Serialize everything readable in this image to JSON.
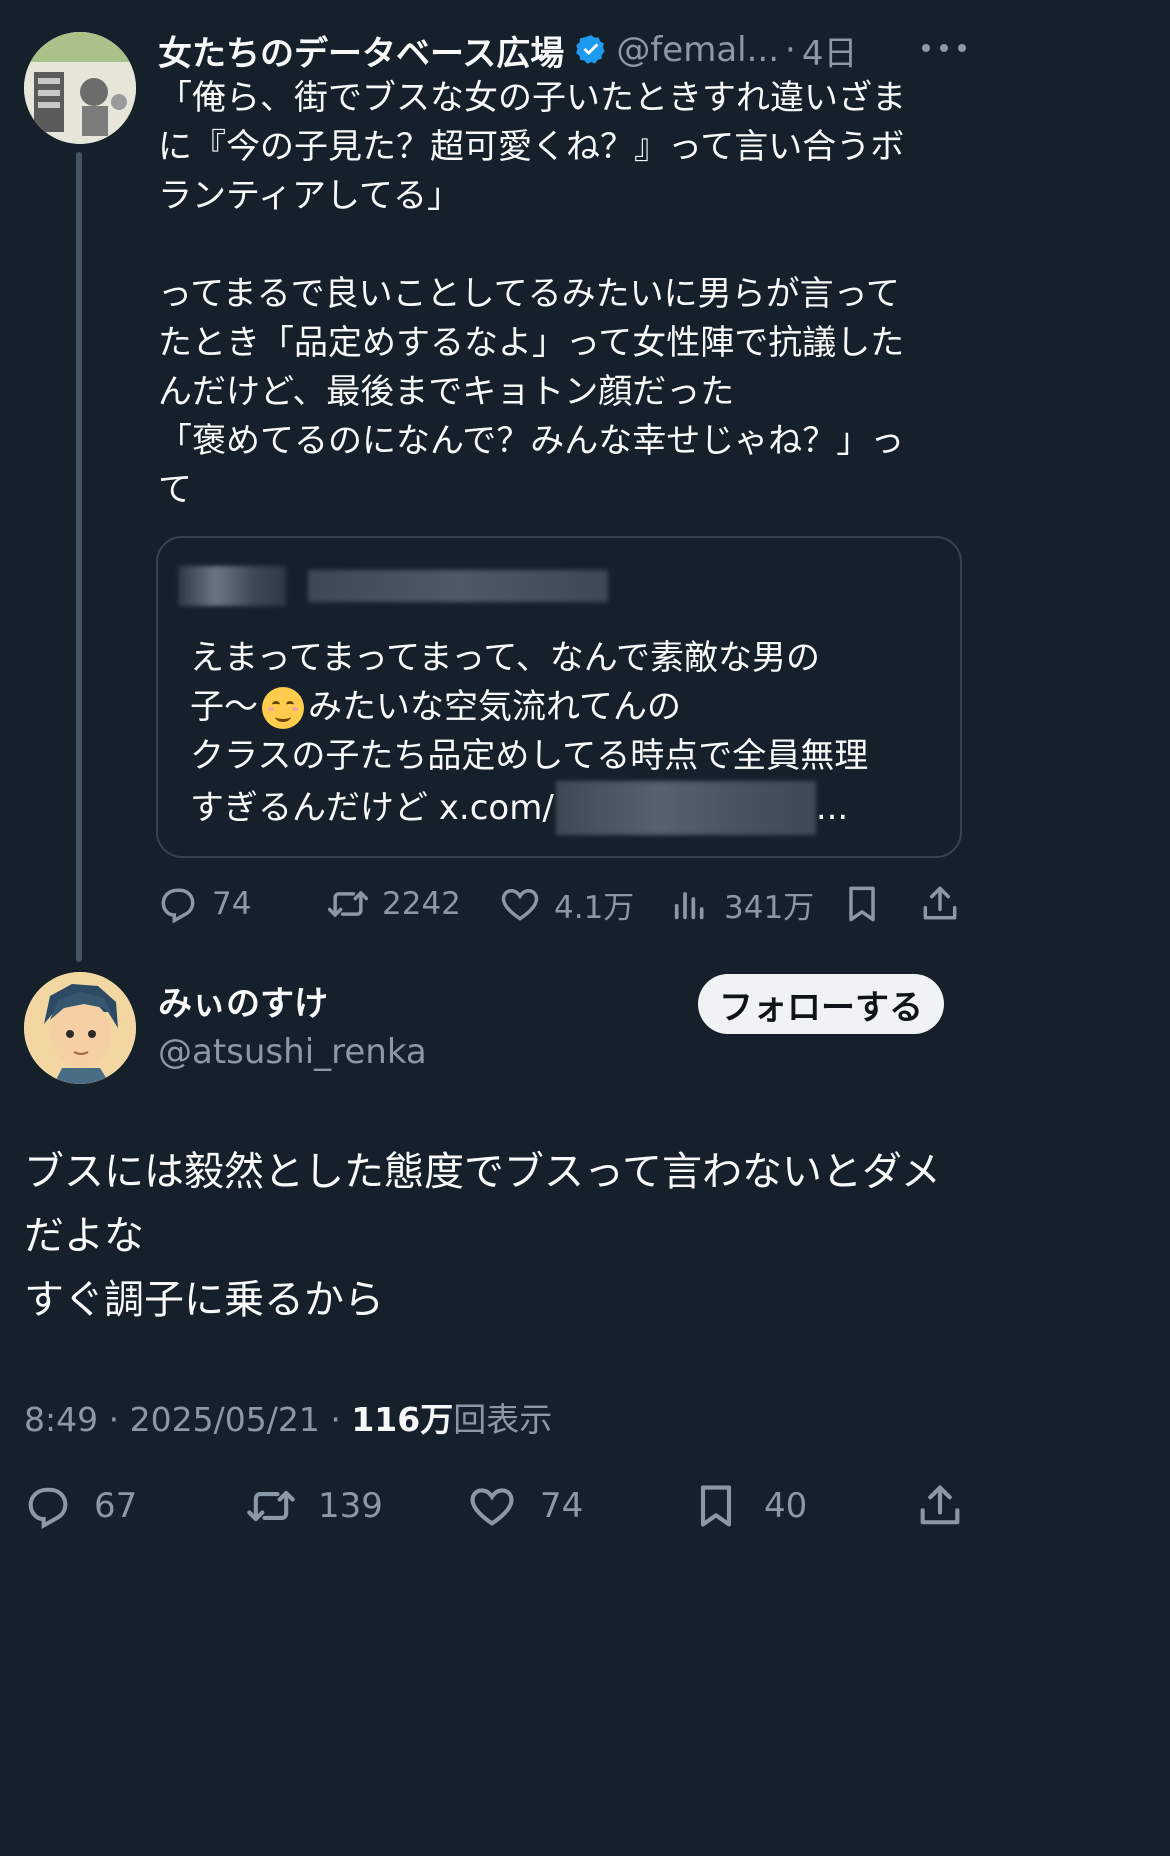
{
  "quoted_tweet": {
    "author_name": "女たちのデータベース広場",
    "author_handle": "@femal...",
    "time": "4日",
    "more_icon": "more-icon",
    "text_lines": [
      "「俺ら、街でブスな女の子いたときすれ違いざま",
      "に『今の子見た？超可愛くね？』って言い合うボ",
      "ランティアしてる」",
      "",
      "ってまるで良いことしてるみたいに男らが言って",
      "たとき「品定めするなよ」って女性陣で抗議した",
      "んだけど、最後までキョトン顔だった",
      "「褒めてるのになんで？みんな幸せじゃね？」っ",
      "て"
    ],
    "embedded": {
      "line1": "えまってまってまって、なんで素敵な男の",
      "line2_before": "子〜",
      "line2_emoji": "☺️",
      "line2_after": "みたいな空気流れてんの",
      "line3": "クラスの子たち品定めしてる時点で全員無理",
      "line4_prefix": "すぎるんだけど x.com/",
      "line4_suffix": "..."
    },
    "actions": {
      "replies": "74",
      "retweets": "2242",
      "likes": "4.1万",
      "views": "341万"
    }
  },
  "main_tweet": {
    "author_name": "みぃのすけ",
    "author_handle": "@atsushi_renka",
    "follow_label": "フォローする",
    "text_lines": [
      "ブスには毅然とした態度でブスって言わないとダメ",
      "だよな",
      "すぐ調子に乗るから"
    ],
    "meta": {
      "time": "8:49",
      "sep1": "·",
      "date": "2025/05/21",
      "sep2": "·",
      "views_count": "116万",
      "views_label": "回表示"
    },
    "actions": {
      "replies": "67",
      "retweets": "139",
      "likes": "74",
      "bookmarks": "40"
    }
  },
  "colors": {
    "background": "#15202b",
    "text": "#f7f9f9",
    "muted": "#8b98a5",
    "verified": "#1d9bf0",
    "border": "#38444d"
  }
}
